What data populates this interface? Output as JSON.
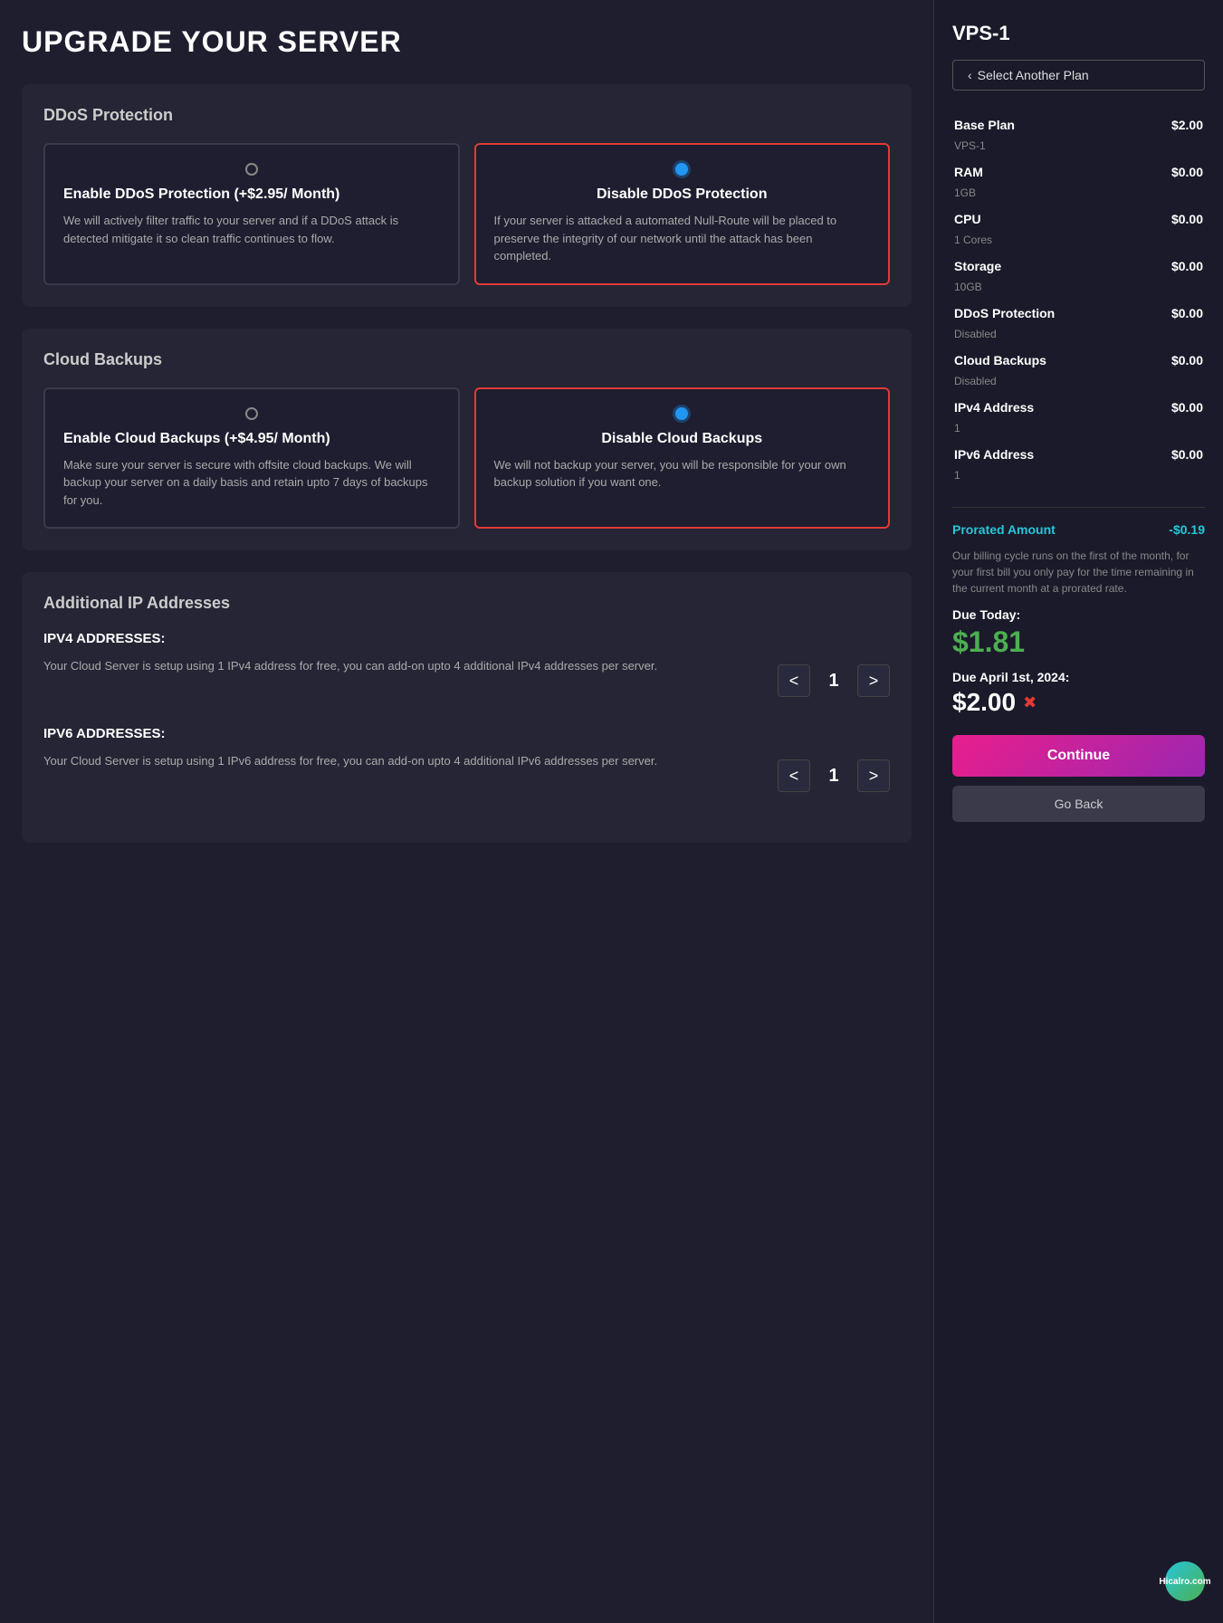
{
  "page": {
    "title": "UPGRADE YOUR SERVER"
  },
  "left": {
    "ddos_section": {
      "title": "DDoS Protection",
      "options": [
        {
          "id": "ddos-enable",
          "title": "Enable DDoS Protection (+$2.95/ Month)",
          "description": "We will actively filter traffic to your server and if a DDoS attack is detected mitigate it so clean traffic continues to flow.",
          "selected": false
        },
        {
          "id": "ddos-disable",
          "title": "Disable DDoS Protection",
          "description": "If your server is attacked a automated Null-Route will be placed to preserve the integrity of our network until the attack has been completed.",
          "selected": true
        }
      ]
    },
    "backups_section": {
      "title": "Cloud Backups",
      "options": [
        {
          "id": "backup-enable",
          "title": "Enable Cloud Backups (+$4.95/ Month)",
          "description": "Make sure your server is secure with offsite cloud backups. We will backup your server on a daily basis and retain upto 7 days of backups for you.",
          "selected": false
        },
        {
          "id": "backup-disable",
          "title": "Disable Cloud Backups",
          "description": "We will not backup your server, you will be responsible for your own backup solution if you want one.",
          "selected": true
        }
      ]
    },
    "ip_section": {
      "title": "Additional IP Addresses",
      "ipv4": {
        "label": "IPV4 ADDRESSES:",
        "description": "Your Cloud Server is setup using 1 IPv4 address for free, you can add-on upto 4 additional IPv4 addresses per server.",
        "value": 1,
        "prev_btn": "<",
        "next_btn": ">"
      },
      "ipv6": {
        "label": "IPV6 ADDRESSES:",
        "description": "Your Cloud Server is setup using 1 IPv6 address for free, you can add-on upto 4 additional IPv6 addresses per server.",
        "value": 1,
        "prev_btn": "<",
        "next_btn": ">"
      }
    }
  },
  "right": {
    "vps_name": "VPS-1",
    "select_plan_btn": "Select Another Plan",
    "price_rows": [
      {
        "label": "Base Plan",
        "price": "$2.00",
        "sub": "VPS-1"
      },
      {
        "label": "RAM",
        "price": "$0.00",
        "sub": "1GB"
      },
      {
        "label": "CPU",
        "price": "$0.00",
        "sub": "1 Cores"
      },
      {
        "label": "Storage",
        "price": "$0.00",
        "sub": "10GB"
      },
      {
        "label": "DDoS Protection",
        "price": "$0.00",
        "sub": "Disabled"
      },
      {
        "label": "Cloud Backups",
        "price": "$0.00",
        "sub": "Disabled"
      },
      {
        "label": "IPv4 Address",
        "price": "$0.00",
        "sub": "1"
      },
      {
        "label": "IPv6 Address",
        "price": "$0.00",
        "sub": "1"
      }
    ],
    "prorated_label": "Prorated Amount",
    "prorated_value": "-$0.19",
    "billing_note": "Our billing cycle runs on the first of the month, for your first bill you only pay for the time remaining in the current month at a prorated rate.",
    "due_today_label": "Due Today:",
    "due_today_amount": "$1.81",
    "due_later_label": "Due April 1st, 2024:",
    "due_later_amount": "$2.00",
    "continue_btn": "Continue",
    "goback_btn": "Go Back",
    "logo_text": "Hicalro.com"
  }
}
